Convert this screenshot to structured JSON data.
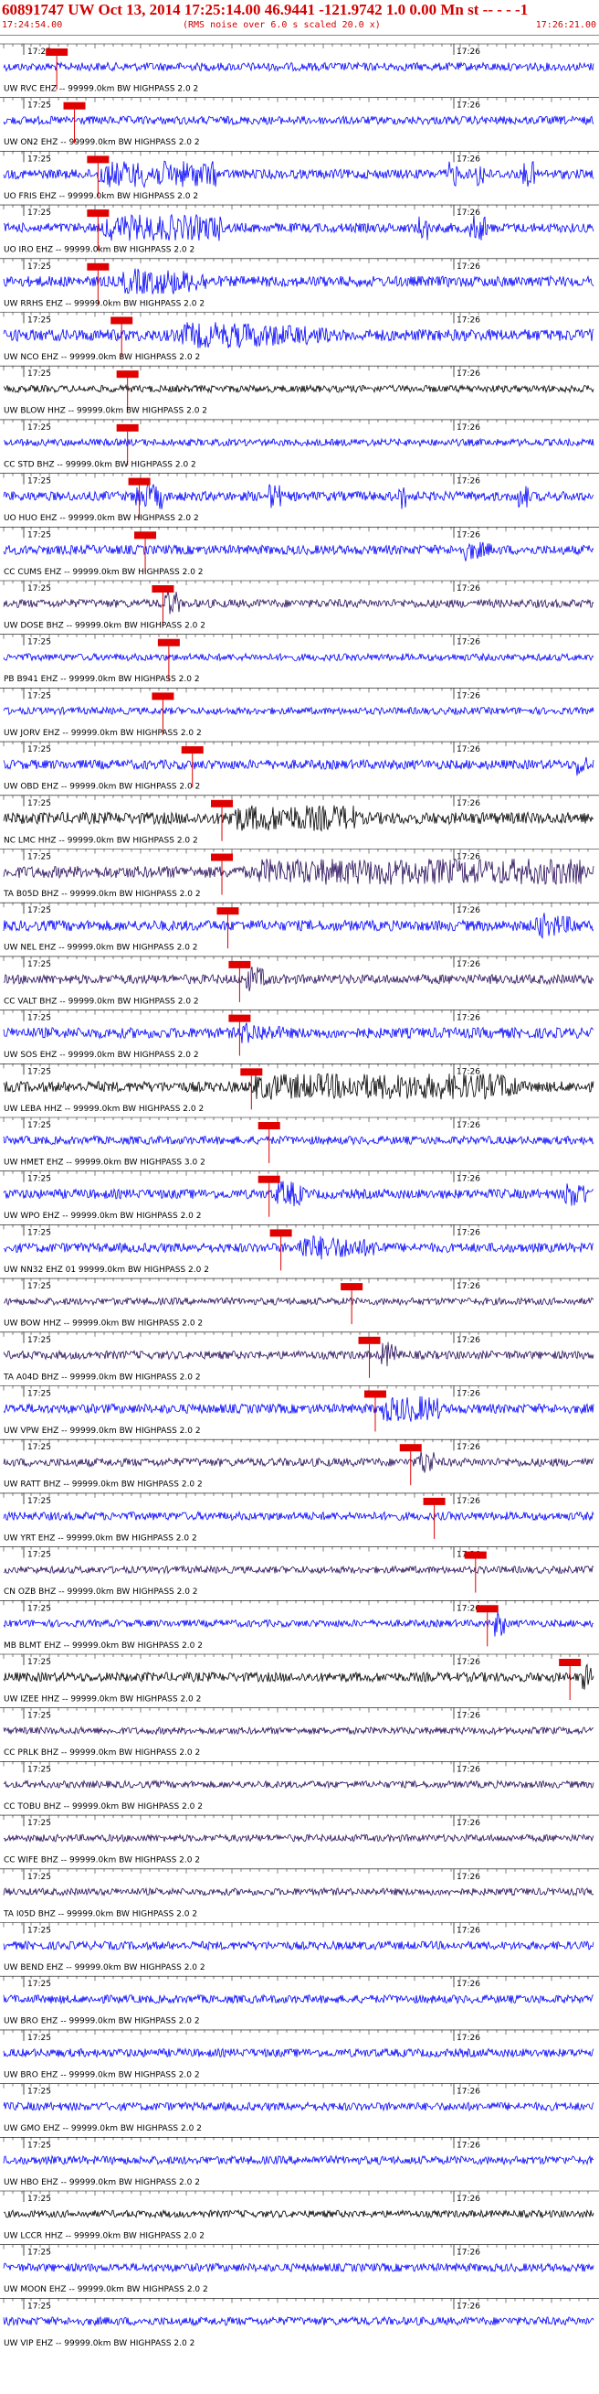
{
  "header": {
    "title": "60891747 UW Oct 13, 2014 17:25:14.00   46.9441 -121.9742  1.0 0.00 Mn st -- - -  -1",
    "start_time": "17:24:54.00",
    "end_time": "17:26:21.00",
    "rms_note": "(RMS noise over 6.0 s scaled 20.0 x)"
  },
  "time_ticks": {
    "left_label": "17:25",
    "right_label": "17:26"
  },
  "colors": {
    "blue": "#0000ff",
    "purple": "#2a0f5c",
    "black": "#000000",
    "pick_red": "#e00000",
    "header_red": "#d40000"
  },
  "traces": [
    {
      "label": "UW RVC EHZ -- 99999.0km BW  HIGHPASS  2.0  2",
      "color": "blue",
      "amp": 0.35,
      "pick": 0.09,
      "bursts": []
    },
    {
      "label": "UW ON2 EHZ -- 99999.0km BW  HIGHPASS  2.0  2",
      "color": "blue",
      "amp": 0.35,
      "pick": 0.12,
      "bursts": []
    },
    {
      "label": "UO FRIS EHZ -- 99999.0km BW  HIGHPASS  2.0  2",
      "color": "blue",
      "amp": 0.4,
      "pick": 0.16,
      "bursts": [
        [
          0.16,
          0.2,
          2.2
        ],
        [
          0.75,
          0.02,
          2.5
        ],
        [
          0.8,
          0.02,
          2.5
        ],
        [
          0.88,
          0.02,
          2.2
        ]
      ]
    },
    {
      "label": "UO IRO EHZ -- 99999.0km BW  HIGHPASS  2.0  2",
      "color": "blue",
      "amp": 0.4,
      "pick": 0.16,
      "bursts": [
        [
          0.17,
          0.2,
          2.4
        ],
        [
          0.7,
          0.02,
          2.5
        ],
        [
          0.79,
          0.03,
          2.5
        ]
      ]
    },
    {
      "label": "UW RRHS EHZ -- 99999.0km BW  HIGHPASS  2.0  2",
      "color": "blue",
      "amp": 0.45,
      "pick": 0.16,
      "bursts": [
        [
          0.2,
          0.15,
          1.5
        ]
      ]
    },
    {
      "label": "UW NCO EHZ -- 99999.0km BW  HIGHPASS  2.0  2",
      "color": "blue",
      "amp": 0.5,
      "pick": 0.2,
      "bursts": [
        [
          0.3,
          0.25,
          1.4
        ]
      ]
    },
    {
      "label": "UW BLOW HHZ -- 99999.0km BW  HIGHPASS  2.0  2",
      "color": "black",
      "amp": 0.3,
      "pick": 0.21,
      "bursts": []
    },
    {
      "label": "CC STD BHZ -- 99999.0km BW  HIGHPASS  2.0  2",
      "color": "blue",
      "amp": 0.3,
      "pick": 0.21,
      "bursts": []
    },
    {
      "label": "UO HUO EHZ -- 99999.0km BW  HIGHPASS  2.0  2",
      "color": "blue",
      "amp": 0.4,
      "pick": 0.23,
      "bursts": [
        [
          0.22,
          0.05,
          2.2
        ],
        [
          0.45,
          0.02,
          2.0
        ],
        [
          0.67,
          0.02,
          2.2
        ],
        [
          0.87,
          0.02,
          2.0
        ]
      ]
    },
    {
      "label": "CC CUMS EHZ -- 99999.0km BW  HIGHPASS  2.0  2",
      "color": "blue",
      "amp": 0.4,
      "pick": 0.24,
      "bursts": [
        [
          0.78,
          0.05,
          1.0
        ]
      ]
    },
    {
      "label": "UW DOSE BHZ -- 99999.0km BW  HIGHPASS  2.0  2",
      "color": "purple",
      "amp": 0.35,
      "pick": 0.27,
      "bursts": [
        [
          0.27,
          0.03,
          1.6
        ]
      ]
    },
    {
      "label": "PB B941 EHZ -- 99999.0km BW  HIGHPASS  2.0  2",
      "color": "blue",
      "amp": 0.3,
      "pick": 0.28,
      "bursts": []
    },
    {
      "label": "UW JORV EHZ -- 99999.0km BW  HIGHPASS  2.0  2",
      "color": "blue",
      "amp": 0.3,
      "pick": 0.27,
      "bursts": []
    },
    {
      "label": "UW OBD EHZ -- 99999.0km BW  HIGHPASS  2.0  2",
      "color": "blue",
      "amp": 0.4,
      "pick": 0.32,
      "bursts": [
        [
          0.97,
          0.02,
          1.6
        ]
      ]
    },
    {
      "label": "NC LMC HHZ -- 99999.0km BW  HIGHPASS  2.0  2",
      "color": "black",
      "amp": 0.5,
      "pick": 0.37,
      "bursts": [
        [
          0.38,
          0.22,
          2.5
        ]
      ]
    },
    {
      "label": "TA B05D BHZ -- 99999.0km BW  HIGHPASS  2.0  2",
      "color": "purple",
      "amp": 0.5,
      "pick": 0.37,
      "bursts": [
        [
          0.43,
          0.55,
          2.6
        ]
      ]
    },
    {
      "label": "UW NEL EHZ -- 99999.0km BW  HIGHPASS  2.0  2",
      "color": "blue",
      "amp": 0.45,
      "pick": 0.38,
      "bursts": [
        [
          0.9,
          0.08,
          1.2
        ]
      ]
    },
    {
      "label": "CC VALT BHZ -- 99999.0km BW  HIGHPASS  2.0  2",
      "color": "purple",
      "amp": 0.4,
      "pick": 0.4,
      "bursts": [
        [
          0.41,
          0.04,
          1.4
        ]
      ]
    },
    {
      "label": "UW SOS EHZ -- 99999.0km BW  HIGHPASS  2.0  2",
      "color": "blue",
      "amp": 0.45,
      "pick": 0.4,
      "bursts": [
        [
          0.4,
          0.08,
          1.0
        ]
      ]
    },
    {
      "label": "UW LEBA HHZ -- 99999.0km BW  HIGHPASS  2.0  2",
      "color": "black",
      "amp": 0.45,
      "pick": 0.42,
      "bursts": [
        [
          0.42,
          0.45,
          2.3
        ]
      ]
    },
    {
      "label": "UW HMET EHZ -- 99999.0km BW  HIGHPASS  3.0  2",
      "color": "blue",
      "amp": 0.35,
      "pick": 0.45,
      "bursts": []
    },
    {
      "label": "UW WPO EHZ -- 99999.0km BW  HIGHPASS  2.0  2",
      "color": "blue",
      "amp": 0.4,
      "pick": 0.45,
      "bursts": [
        [
          0.46,
          0.05,
          1.6
        ],
        [
          0.95,
          0.04,
          1.8
        ]
      ]
    },
    {
      "label": "UW NN32 EHZ 01 99999.0km BW  HIGHPASS  2.0  2",
      "color": "blue",
      "amp": 0.4,
      "pick": 0.47,
      "bursts": [
        [
          0.5,
          0.15,
          1.2
        ]
      ]
    },
    {
      "label": "UW BOW HHZ -- 99999.0km BW  HIGHPASS  2.0  2",
      "color": "purple",
      "amp": 0.3,
      "pick": 0.59,
      "bursts": []
    },
    {
      "label": "TA A04D BHZ -- 99999.0km BW  HIGHPASS  2.0  2",
      "color": "purple",
      "amp": 0.35,
      "pick": 0.62,
      "bursts": [
        [
          0.64,
          0.03,
          1.6
        ]
      ]
    },
    {
      "label": "UW VPW EHZ -- 99999.0km BW  HIGHPASS  2.0  2",
      "color": "blue",
      "amp": 0.4,
      "pick": 0.63,
      "bursts": [
        [
          0.64,
          0.1,
          1.8
        ]
      ]
    },
    {
      "label": "UW RATT BHZ -- 99999.0km BW  HIGHPASS  2.0  2",
      "color": "purple",
      "amp": 0.35,
      "pick": 0.69,
      "bursts": [
        [
          0.7,
          0.03,
          2.0
        ]
      ]
    },
    {
      "label": "UW YRT EHZ -- 99999.0km BW  HIGHPASS  2.0  2",
      "color": "blue",
      "amp": 0.35,
      "pick": 0.73,
      "bursts": []
    },
    {
      "label": "CN OZB BHZ -- 99999.0km BW  HIGHPASS  2.0  2",
      "color": "purple",
      "amp": 0.3,
      "pick": 0.8,
      "bursts": []
    },
    {
      "label": "MB BLMT EHZ -- 99999.0km BW  HIGHPASS  2.0  2",
      "color": "blue",
      "amp": 0.3,
      "pick": 0.82,
      "bursts": [
        [
          0.83,
          0.02,
          2.0
        ]
      ]
    },
    {
      "label": "UW IZEE HHZ -- 99999.0km BW  HIGHPASS  2.0  2",
      "color": "black",
      "amp": 0.4,
      "pick": 0.96,
      "bursts": [
        [
          0.98,
          0.02,
          2.5
        ]
      ]
    },
    {
      "label": "CC PRLK BHZ -- 99999.0km BW  HIGHPASS  2.0  2",
      "color": "purple",
      "amp": 0.3,
      "pick": null,
      "bursts": []
    },
    {
      "label": "CC TOBU BHZ -- 99999.0km BW  HIGHPASS  2.0  2",
      "color": "purple",
      "amp": 0.3,
      "pick": null,
      "bursts": []
    },
    {
      "label": "CC WIFE BHZ -- 99999.0km BW  HIGHPASS  2.0  2",
      "color": "purple",
      "amp": 0.3,
      "pick": null,
      "bursts": []
    },
    {
      "label": "TA I05D BHZ -- 99999.0km BW  HIGHPASS  2.0  2",
      "color": "purple",
      "amp": 0.3,
      "pick": null,
      "bursts": []
    },
    {
      "label": "UW BEND EHZ -- 99999.0km BW  HIGHPASS  2.0  2",
      "color": "blue",
      "amp": 0.35,
      "pick": null,
      "bursts": []
    },
    {
      "label": "UW BRO EHZ -- 99999.0km BW  HIGHPASS  2.0  2",
      "color": "blue",
      "amp": 0.35,
      "pick": null,
      "bursts": []
    },
    {
      "label": "UW BRO EHZ -- 99999.0km BW  HIGHPASS  2.0  2",
      "color": "blue",
      "amp": 0.35,
      "pick": null,
      "bursts": []
    },
    {
      "label": "UW GMO EHZ -- 99999.0km BW  HIGHPASS  2.0  2",
      "color": "blue",
      "amp": 0.35,
      "pick": null,
      "bursts": []
    },
    {
      "label": "UW HBO EHZ -- 99999.0km BW  HIGHPASS  2.0  2",
      "color": "blue",
      "amp": 0.35,
      "pick": null,
      "bursts": []
    },
    {
      "label": "UW LCCR HHZ -- 99999.0km BW  HIGHPASS  2.0  2",
      "color": "black",
      "amp": 0.3,
      "pick": null,
      "bursts": []
    },
    {
      "label": "UW MOON EHZ -- 99999.0km BW  HIGHPASS  2.0  2",
      "color": "blue",
      "amp": 0.35,
      "pick": null,
      "bursts": []
    },
    {
      "label": "UW VIP EHZ -- 99999.0km BW  HIGHPASS  2.0  2",
      "color": "blue",
      "amp": 0.35,
      "pick": null,
      "bursts": []
    }
  ]
}
